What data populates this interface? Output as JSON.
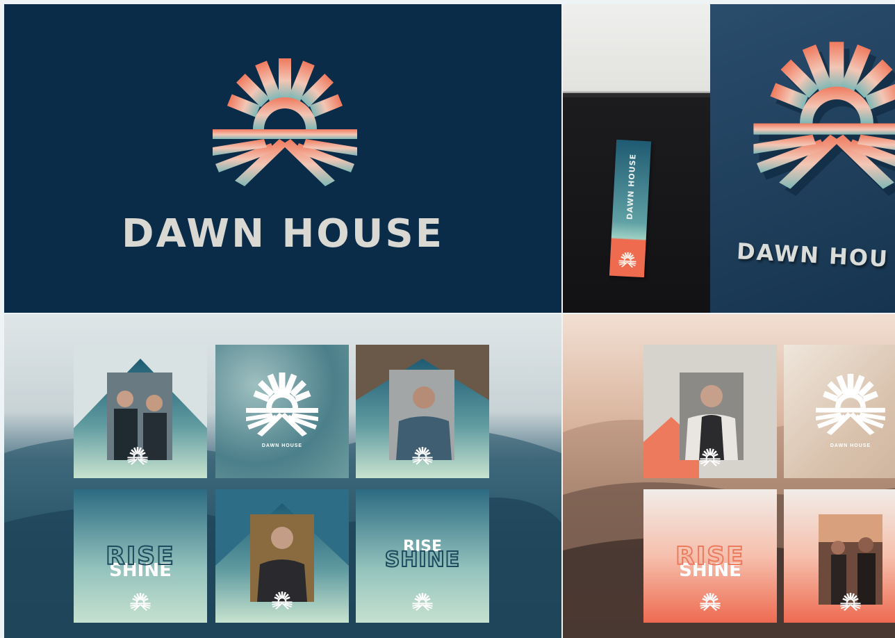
{
  "brand": {
    "name": "DAWN HOUSE",
    "tag_name": "DAWN HOUSE",
    "sign_name": "DAWN HOU",
    "tile_name": "DAWN HOUSE",
    "rise_word": "RISE",
    "shine_word": "SHINE"
  },
  "colors": {
    "navy": "#0a2c48",
    "coral": "#f08266",
    "peach": "#f2b7a0",
    "teal": "#4f8b96",
    "mint": "#c6e1cf",
    "cream": "#e7e4dc"
  },
  "icons": [
    "sunrise-logo-icon"
  ]
}
